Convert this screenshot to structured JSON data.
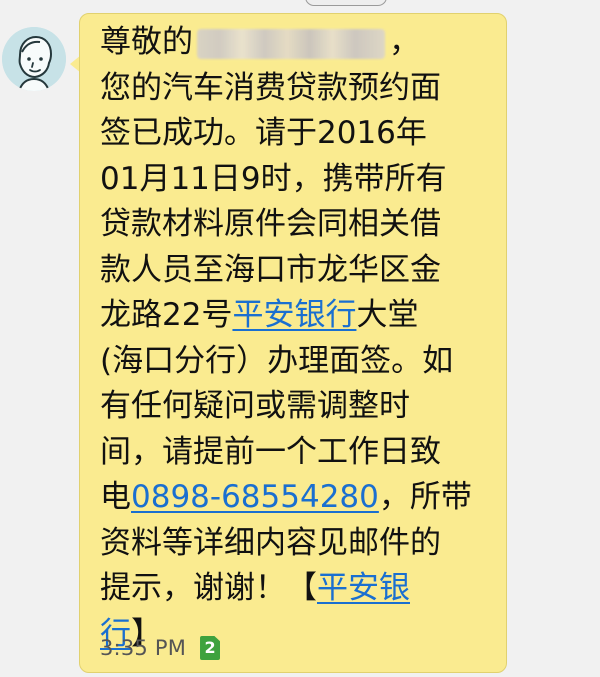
{
  "message": {
    "line1": {
      "start": "尊敬的",
      "end": "，"
    },
    "line2": "您的汽车消费贷款预约面",
    "line3": "签已成功。请于2016年",
    "line4": "01月11日9时，携带所有",
    "line5": "贷款材料原件会同相关借",
    "line6": "款人员至海口市龙华区金",
    "line7": {
      "start": "龙路22号",
      "link": "平安银行",
      "end": "大堂"
    },
    "line8": "(海口分行）办理面签。如",
    "line9": "有任何疑问或需调整时",
    "line10": "间，请提前一个工作日致",
    "line11": {
      "start": "电",
      "link": "0898-68554280",
      "end": "，所带"
    },
    "line12": "资料等详细内容见邮件的",
    "line13": {
      "start": "提示，谢谢！【",
      "link": "平安银"
    },
    "line14": {
      "link": "行",
      "end": "】"
    }
  },
  "meta": {
    "time": "3:35 PM",
    "sim_slot": "2"
  },
  "colors": {
    "bubble": "#faeb90",
    "link": "#1a6fd0",
    "sim_badge": "#3ea23e",
    "avatar_bg": "#c7e2e7"
  },
  "icons": {
    "avatar": "default-contact-avatar-icon",
    "sim": "sim-card-icon"
  }
}
